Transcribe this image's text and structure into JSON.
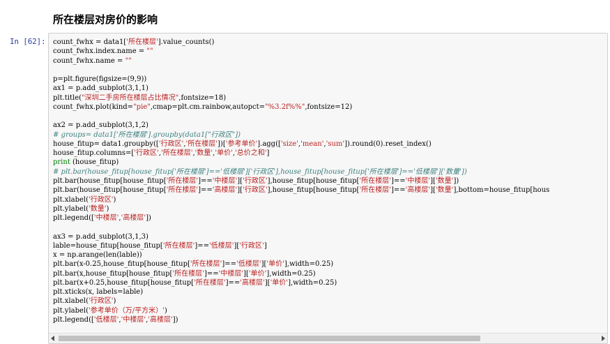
{
  "section_title": "所在楼层对房价的影响",
  "prompt": "In  [62]:",
  "code_lines": [
    [
      [
        "",
        "count_fwhx = data1["
      ],
      [
        "str",
        "'所在楼层'"
      ],
      [
        "",
        "].value_counts()"
      ]
    ],
    [
      [
        "",
        "count_fwhx.index.name = "
      ],
      [
        "str",
        "\"\""
      ]
    ],
    [
      [
        "",
        "count_fwhx.name = "
      ],
      [
        "str",
        "\"\""
      ]
    ],
    [
      [
        "",
        ""
      ]
    ],
    [
      [
        "",
        "p=plt.figure(figsize=(9,9))"
      ]
    ],
    [
      [
        "",
        "ax1 = p.add_subplot(3,1,1)"
      ]
    ],
    [
      [
        "",
        "plt.title("
      ],
      [
        "str",
        "\"深圳二手房所在楼层占比情况\""
      ],
      [
        "",
        ",fontsize=18)"
      ]
    ],
    [
      [
        "",
        "count_fwhx.plot(kind="
      ],
      [
        "str",
        "\"pie\""
      ],
      [
        "",
        ",cmap=plt.cm.rainbow,autopct="
      ],
      [
        "str",
        "\"%3.2f%%\""
      ],
      [
        "",
        ",fontsize=12)"
      ]
    ],
    [
      [
        "",
        ""
      ]
    ],
    [
      [
        "",
        "ax2 = p.add_subplot(3,1,2)"
      ]
    ],
    [
      [
        "com",
        "# groups= data1['所在楼层'].groupby(data1[\"行政区\"])"
      ]
    ],
    [
      [
        "",
        "house_fitup= data1.groupby(["
      ],
      [
        "str",
        "'行政区'"
      ],
      [
        "",
        ","
      ],
      [
        "str",
        "'所在楼层'"
      ],
      [
        "",
        "])["
      ],
      [
        "str",
        "'参考单价'"
      ],
      [
        "",
        "].agg(["
      ],
      [
        "str",
        "'size'"
      ],
      [
        "",
        ","
      ],
      [
        "str",
        "'mean'"
      ],
      [
        "",
        ","
      ],
      [
        "str",
        "'sum'"
      ],
      [
        "",
        "]).round(0).reset_index()"
      ]
    ],
    [
      [
        "",
        "house_fitup.columns=["
      ],
      [
        "str",
        "'行政区'"
      ],
      [
        "",
        ","
      ],
      [
        "str",
        "'所在楼层'"
      ],
      [
        "",
        ","
      ],
      [
        "str",
        "'数量'"
      ],
      [
        "",
        ","
      ],
      [
        "str",
        "'单价'"
      ],
      [
        "",
        ","
      ],
      [
        "str",
        "'总价之和'"
      ],
      [
        "",
        "]"
      ]
    ],
    [
      [
        "kw",
        "print"
      ],
      [
        "",
        " (house_fitup)"
      ]
    ],
    [
      [
        "com",
        "# plt.bar(house_fitup[house_fitup['所在楼层']=='低楼层']['行政区'],house_fitup[house_fitup['所在楼层']=='低楼层']['数量'])"
      ]
    ],
    [
      [
        "",
        "plt.bar(house_fitup[house_fitup["
      ],
      [
        "str",
        "'所在楼层'"
      ],
      [
        "",
        "]=="
      ],
      [
        "str",
        "'中楼层'"
      ],
      [
        "",
        "]["
      ],
      [
        "str",
        "'行政区'"
      ],
      [
        "",
        "],house_fitup[house_fitup["
      ],
      [
        "str",
        "'所在楼层'"
      ],
      [
        "",
        "]=="
      ],
      [
        "str",
        "'中楼层'"
      ],
      [
        "",
        "]["
      ],
      [
        "str",
        "'数量'"
      ],
      [
        "",
        "])"
      ]
    ],
    [
      [
        "",
        "plt.bar(house_fitup[house_fitup["
      ],
      [
        "str",
        "'所在楼层'"
      ],
      [
        "",
        "]=="
      ],
      [
        "str",
        "'高楼层'"
      ],
      [
        "",
        "]["
      ],
      [
        "str",
        "'行政区'"
      ],
      [
        "",
        "],house_fitup[house_fitup["
      ],
      [
        "str",
        "'所在楼层'"
      ],
      [
        "",
        "]=="
      ],
      [
        "str",
        "'高楼层'"
      ],
      [
        "",
        "]["
      ],
      [
        "str",
        "'数量'"
      ],
      [
        "",
        "],bottom=house_fitup[hous"
      ]
    ],
    [
      [
        "",
        "plt.xlabel("
      ],
      [
        "str",
        "'行政区'"
      ],
      [
        "",
        ")"
      ]
    ],
    [
      [
        "",
        "plt.ylabel("
      ],
      [
        "str",
        "'数量'"
      ],
      [
        "",
        ")"
      ]
    ],
    [
      [
        "",
        "plt.legend(["
      ],
      [
        "str",
        "'中楼层'"
      ],
      [
        "",
        ","
      ],
      [
        "str",
        "'高楼层'"
      ],
      [
        "",
        "])"
      ]
    ],
    [
      [
        "",
        ""
      ]
    ],
    [
      [
        "",
        "ax3 = p.add_subplot(3,1,3)"
      ]
    ],
    [
      [
        "",
        "lable=house_fitup[house_fitup["
      ],
      [
        "str",
        "'所在楼层'"
      ],
      [
        "",
        "]=="
      ],
      [
        "str",
        "'低楼层'"
      ],
      [
        "",
        "]["
      ],
      [
        "str",
        "'行政区'"
      ],
      [
        "",
        "]"
      ]
    ],
    [
      [
        "",
        "x = np.arange(len(lable))"
      ]
    ],
    [
      [
        "",
        "plt.bar(x-0.25,house_fitup[house_fitup["
      ],
      [
        "str",
        "'所在楼层'"
      ],
      [
        "",
        "]=="
      ],
      [
        "str",
        "'低楼层'"
      ],
      [
        "",
        "]["
      ],
      [
        "str",
        "'单价'"
      ],
      [
        "",
        "],width=0.25)"
      ]
    ],
    [
      [
        "",
        "plt.bar(x,house_fitup[house_fitup["
      ],
      [
        "str",
        "'所在楼层'"
      ],
      [
        "",
        "]=="
      ],
      [
        "str",
        "'中楼层'"
      ],
      [
        "",
        "]["
      ],
      [
        "str",
        "'单价'"
      ],
      [
        "",
        "],width=0.25)"
      ]
    ],
    [
      [
        "",
        "plt.bar(x+0.25,house_fitup[house_fitup["
      ],
      [
        "str",
        "'所在楼层'"
      ],
      [
        "",
        "]=="
      ],
      [
        "str",
        "'高楼层'"
      ],
      [
        "",
        "]["
      ],
      [
        "str",
        "'单价'"
      ],
      [
        "",
        "],width=0.25)"
      ]
    ],
    [
      [
        "",
        "plt.xticks(x, labels=lable)"
      ]
    ],
    [
      [
        "",
        "plt.xlabel("
      ],
      [
        "str",
        "'行政区'"
      ],
      [
        "",
        ")"
      ]
    ],
    [
      [
        "",
        "plt.ylabel("
      ],
      [
        "str",
        "'参考单价（万/平方米）'"
      ],
      [
        "",
        ")"
      ]
    ],
    [
      [
        "",
        "plt.legend(["
      ],
      [
        "str",
        "'低楼层'"
      ],
      [
        "",
        ","
      ],
      [
        "str",
        "'中楼层'"
      ],
      [
        "",
        ","
      ],
      [
        "str",
        "'高楼层'"
      ],
      [
        "",
        "])"
      ]
    ]
  ]
}
